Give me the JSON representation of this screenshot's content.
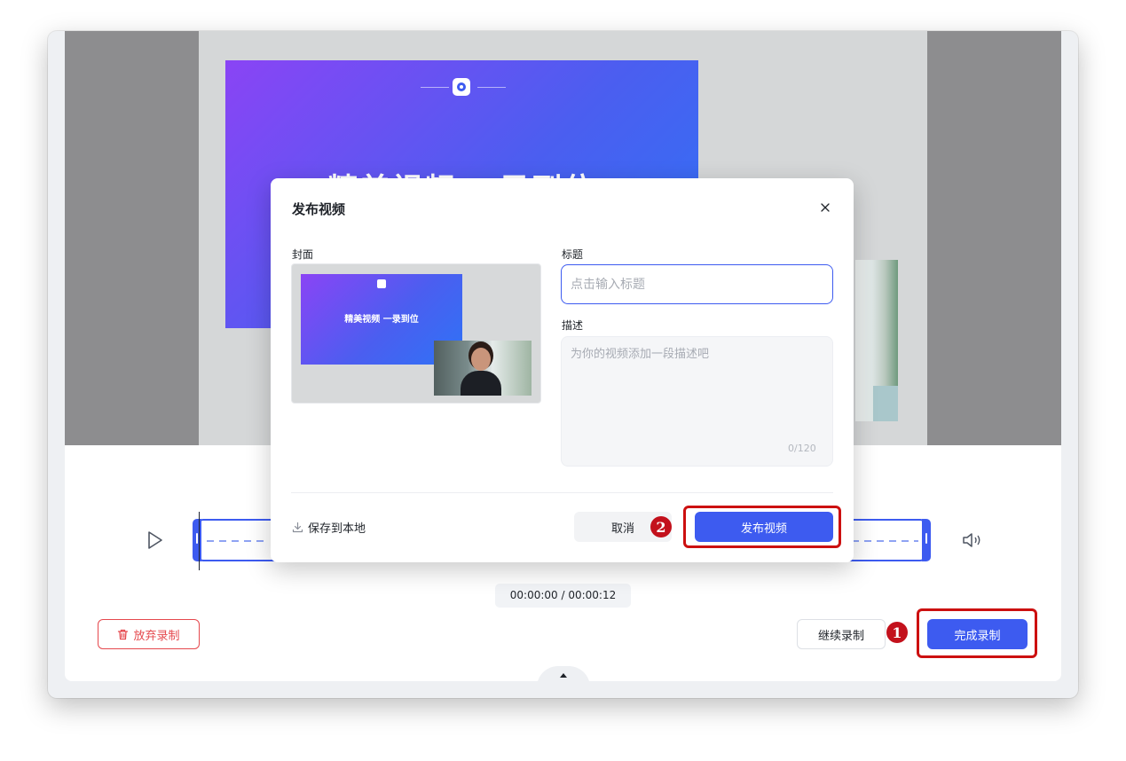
{
  "preview": {
    "slide_title": "精美视频  一录到位"
  },
  "player": {
    "time_current": "00:00:00",
    "time_separator": " / ",
    "time_total": "00:00:12"
  },
  "actions": {
    "discard_label": "放弃录制",
    "continue_label": "继续录制",
    "finish_label": "完成录制"
  },
  "modal": {
    "title": "发布视频",
    "cover_label": "封面",
    "cover_slide_text": "精美视频  一录到位",
    "title_label": "标题",
    "title_value": "",
    "title_placeholder": "点击输入标题",
    "description_label": "描述",
    "description_value": "",
    "description_placeholder": "为你的视频添加一段描述吧",
    "char_count": "0/120",
    "save_local_label": "保存到本地",
    "cancel_label": "取消",
    "publish_label": "发布视频"
  },
  "callouts": {
    "step1": "1",
    "step2": "2"
  },
  "colors": {
    "accent": "#3d5bf0",
    "danger": "#e5484d",
    "callout": "#cc1010"
  },
  "icons": {
    "play": "play-icon",
    "volume": "volume-icon",
    "close": "close-icon",
    "trash": "trash-icon",
    "download": "download-icon",
    "chevron_up": "chevron-up-icon"
  }
}
